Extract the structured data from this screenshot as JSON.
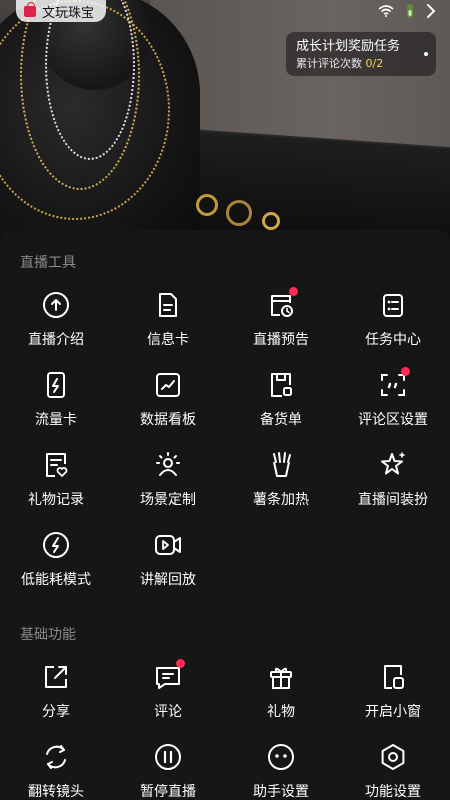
{
  "status_bar": {
    "shop_name": "文玩珠宝",
    "icons": [
      "wifi-icon",
      "battery-icon",
      "chevron-right-icon"
    ]
  },
  "task_card": {
    "title": "成长计划奖励任务",
    "subtitle": "累计评论次数",
    "progress": "0/2"
  },
  "sections": [
    {
      "title": "直播工具",
      "items": [
        {
          "label": "直播介绍",
          "icon": "upload-circle-icon",
          "badge": false
        },
        {
          "label": "信息卡",
          "icon": "document-icon",
          "badge": false
        },
        {
          "label": "直播预告",
          "icon": "calendar-clock-icon",
          "badge": true
        },
        {
          "label": "任务中心",
          "icon": "checklist-icon",
          "badge": false
        },
        {
          "label": "流量卡",
          "icon": "lightning-card-icon",
          "badge": false
        },
        {
          "label": "数据看板",
          "icon": "line-chart-icon",
          "badge": false
        },
        {
          "label": "备货单",
          "icon": "stock-list-icon",
          "badge": false
        },
        {
          "label": "评论区设置",
          "icon": "comment-frame-icon",
          "badge": true
        },
        {
          "label": "礼物记录",
          "icon": "gift-record-icon",
          "badge": false
        },
        {
          "label": "场景定制",
          "icon": "scene-icon",
          "badge": false
        },
        {
          "label": "薯条加热",
          "icon": "fries-icon",
          "badge": false
        },
        {
          "label": "直播间装扮",
          "icon": "sparkle-star-icon",
          "badge": false
        },
        {
          "label": "低能耗模式",
          "icon": "low-power-icon",
          "badge": false
        },
        {
          "label": "讲解回放",
          "icon": "video-replay-icon",
          "badge": false
        }
      ]
    },
    {
      "title": "基础功能",
      "items": [
        {
          "label": "分享",
          "icon": "share-icon",
          "badge": false
        },
        {
          "label": "评论",
          "icon": "comment-icon",
          "badge": true
        },
        {
          "label": "礼物",
          "icon": "gift-icon",
          "badge": false
        },
        {
          "label": "开启小窗",
          "icon": "mini-window-icon",
          "badge": false
        },
        {
          "label": "翻转镜头",
          "icon": "flip-camera-icon",
          "badge": false
        },
        {
          "label": "暂停直播",
          "icon": "pause-icon",
          "badge": false
        },
        {
          "label": "助手设置",
          "icon": "assistant-icon",
          "badge": false
        },
        {
          "label": "功能设置",
          "icon": "settings-icon",
          "badge": false
        }
      ]
    }
  ],
  "colors": {
    "badge": "#fe2c55",
    "sheet_bg": "#161616",
    "section_title": "#8a8a8a",
    "progress": "#f5d34a"
  }
}
